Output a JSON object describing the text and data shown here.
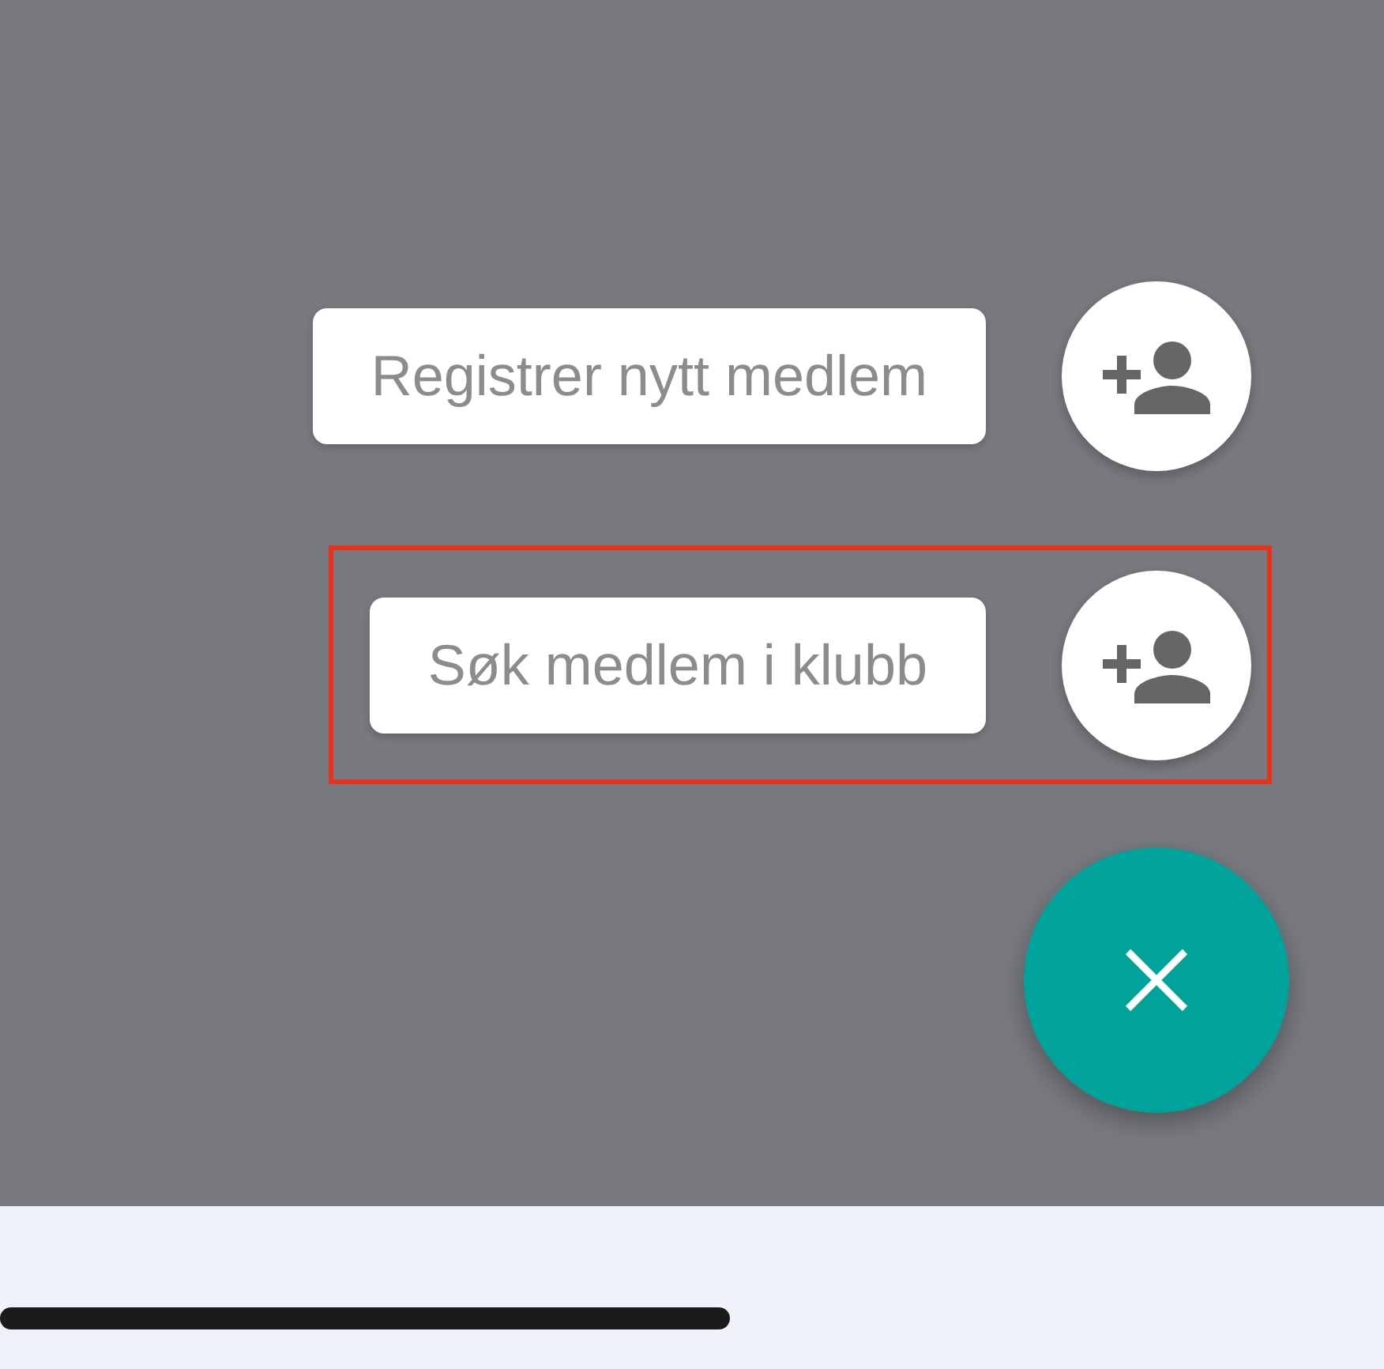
{
  "speed_dial": {
    "actions": [
      {
        "label": "Registrer nytt medlem",
        "highlighted": false
      },
      {
        "label": "Søk medlem i klubb",
        "highlighted": true
      }
    ],
    "close_button": {
      "expanded": true
    }
  }
}
